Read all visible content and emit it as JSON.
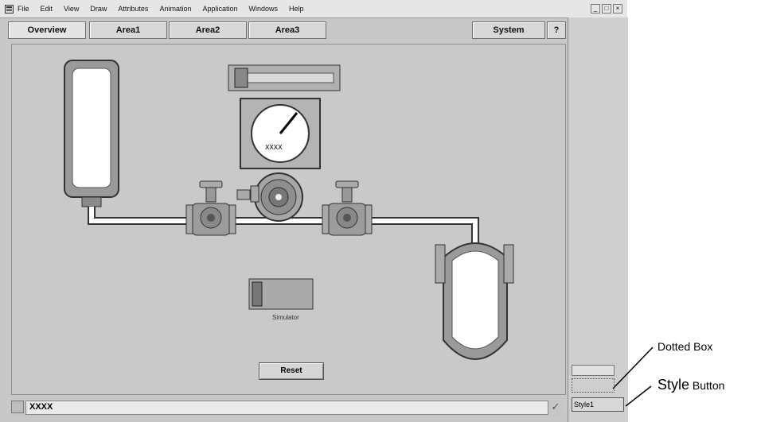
{
  "menu": [
    "File",
    "Edit",
    "View",
    "Draw",
    "Attributes",
    "Animation",
    "Application",
    "Windows",
    "Help"
  ],
  "tabs": {
    "overview": "Overview",
    "area1": "Area1",
    "area2": "Area2",
    "area3": "Area3",
    "system": "System",
    "help": "?"
  },
  "gauge": {
    "readout": "XXXX"
  },
  "simulator": {
    "label": "Simulator",
    "reset_label": "Reset"
  },
  "status": {
    "text": "XXXX"
  },
  "right_panel": {
    "style_button_label": "Style1"
  },
  "annotations": {
    "dotted_box": "Dotted Box",
    "style_button_word": "Style",
    "style_button_suffix": " Button"
  }
}
